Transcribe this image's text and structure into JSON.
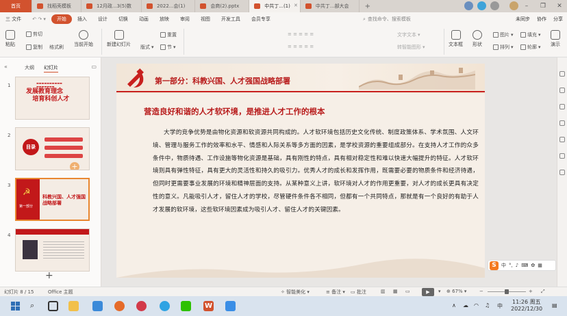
{
  "tabs": [
    {
      "label": "首页",
      "kind": "home"
    },
    {
      "label": "找稻壳模板",
      "color": "#d2522e"
    },
    {
      "label": "12月政...3(5)数",
      "color": "#d2522e"
    },
    {
      "label": "2022...会(1)",
      "color": "#d2522e"
    },
    {
      "label": "会商(2).pptx",
      "color": "#d2522e"
    },
    {
      "label": "中共丁...(1)",
      "color": "#d2522e",
      "active": true
    },
    {
      "label": "中共丁...部大会",
      "color": "#d2522e"
    }
  ],
  "menu": {
    "file": "三 文件",
    "items": [
      "开始",
      "插入",
      "设计",
      "切换",
      "动画",
      "放映",
      "审阅",
      "视图",
      "开发工具",
      "会员专享"
    ],
    "active": "开始",
    "search_placeholder": "查找命令、搜索模板",
    "right": [
      "未同步",
      "协作",
      "分享"
    ]
  },
  "ribbon": {
    "paste": "粘贴",
    "cut": "剪切",
    "copy": "复制",
    "format_painter": "格式刷",
    "play_from_current": "当前开始",
    "new_slide": "新建幻灯片",
    "layout": "版式",
    "section": "节",
    "reset": "重置",
    "format_letters": [
      "B",
      "I",
      "U",
      "S",
      "X²",
      "X₂",
      "A"
    ],
    "text_box": "文本框",
    "shape": "形状",
    "arrange": "排列",
    "picture": "图片",
    "fill": "填充",
    "outline": "轮廓",
    "text_tool": "文字文本",
    "convert_smartart": "转智能图形",
    "play": "演示"
  },
  "left_panel": {
    "tab_outline": "大纲",
    "tab_slides": "幻灯片",
    "slides": [
      {
        "num": "1",
        "line1": "发展教育理念",
        "line2": "培育科创人才"
      },
      {
        "num": "2",
        "line1": "目录",
        "line2": ""
      },
      {
        "num": "3",
        "line1": "第一部分",
        "line2": "科教兴国、人才强国战略部署"
      },
      {
        "num": "4",
        "line1": "",
        "line2": ""
      }
    ],
    "add": "+"
  },
  "slide": {
    "section_title": "第一部分：科教兴国、人才强国战略部署",
    "subtitle": "营造良好和谐的人才软环境，是推进人才工作的根本",
    "body": "大学的竞争优势是由物化资源和软资源共同构成的。人才软环境包括历史文化传统、制度政策体系、学术氛围、人文环境、管理与服务工作的效率和水平、情感和人际关系等多方面的因素，是学校资源的重要组成部分。在支持人才工作的众多条件中，物质待遇、工作设施等物化资源是基础，具有刚性的特点，具有相对稳定性和难以快速大幅提升的特征。人才软环境则具有弹性特征，具有更大的灵活性和持久的吸引力。优秀人才的成长和发挥作用，既需要必要的物质条件和经济待遇，但同时更需要事业发展的环境和精神层面的支持。从某种意义上讲，软环境对人才的作用更重要，对人才的成长更具有决定性的意义。凡能吸引人才，留住人才的学校，尽管硬件条件各不相同，但都有一个共同特点，那就是有一个良好的有助于人才发展的软环境，这些软环境因素成为吸引人才、留住人才的关键因素。"
  },
  "ime": {
    "logo": "S",
    "lang": "中"
  },
  "statusbar": {
    "slide_count": "幻灯片 8 / 15",
    "theme": "Office 主题",
    "beautify": "智能美化",
    "notes": "备注",
    "comments": "批注",
    "zoom": "67%"
  },
  "taskbar": {
    "time": "11:26 周五",
    "date": "2022/12/30",
    "lang": "中",
    "search_icon": "search-icon"
  },
  "colors": {
    "accent": "#d2522e",
    "slide_red": "#b81c1c"
  }
}
